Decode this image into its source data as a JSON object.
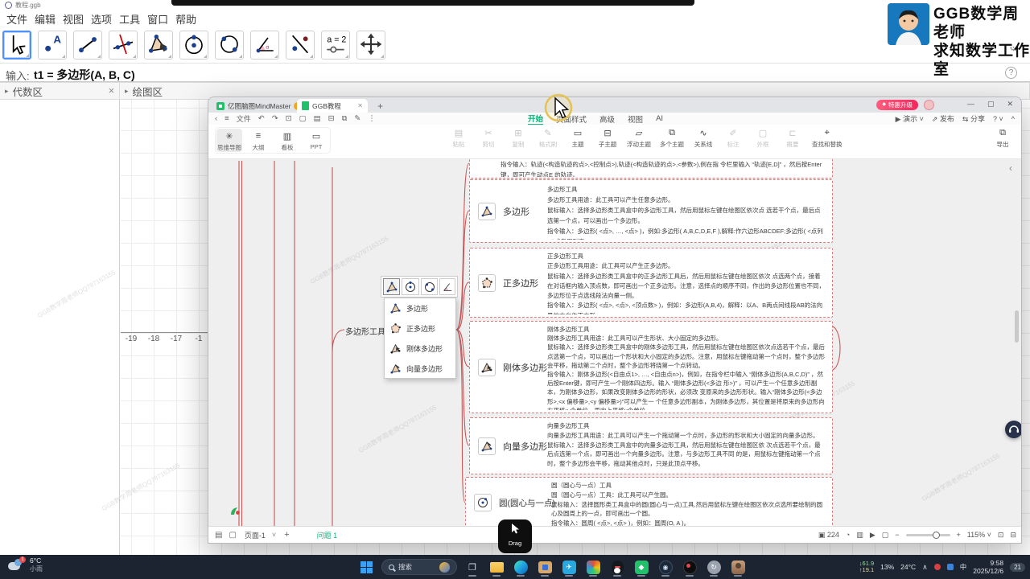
{
  "colors": {
    "mindmaster_green": "#12b27c",
    "dashed_red": "#d97b7b",
    "ggb_select_blue": "#4d90fe",
    "taskbar_bg": "#1b2430",
    "pro_orange": "#f7a41d"
  },
  "ggb": {
    "window_title": "教程.ggb",
    "menu": [
      "文件",
      "编辑",
      "视图",
      "选项",
      "工具",
      "窗口",
      "帮助"
    ],
    "input_label": "输入:",
    "input_value": "t1 = 多边形(A, B, C)",
    "algebra_panel_title": "代数区",
    "graphics_panel_title": "绘图区",
    "axis_labels": [
      "-19",
      "-18",
      "-17",
      "-1"
    ],
    "slider_tool_label": "a = 2",
    "brand_line1": "GGB数学周老师",
    "brand_line2": "求知数学工作室"
  },
  "mindmaster": {
    "tab_home": {
      "title": "亿图脑图MindMaster",
      "badge": "Pro"
    },
    "tab_doc": {
      "title": "GGB教程"
    },
    "new_tab": "+",
    "promo_badge": "特惠升级",
    "file_menu": "文件",
    "ribbon_tabs": [
      "开始",
      "页面样式",
      "高级",
      "视图",
      "AI"
    ],
    "quick_actions": [
      "演示",
      "发布",
      "分享"
    ],
    "view_modes": [
      "思维导图",
      "大纲",
      "看板",
      "PPT"
    ],
    "ribbon_items": [
      "粘贴",
      "剪切",
      "复制",
      "格式刷",
      "主题",
      "子主题",
      "浮动主题",
      "多个主题",
      "关系线",
      "标注",
      "外框",
      "概要",
      "查找和替换"
    ],
    "export_label": "导出",
    "status_left": {
      "page_tab": "页面-1",
      "green_label": "问题 1"
    },
    "status_right": {
      "topic_count": "224",
      "zoom_percent": "115%"
    },
    "drag_overlay": "Drag",
    "canvas": {
      "central_topic": "多边形工具",
      "toolbox_items": [
        "多边形",
        "正多边形",
        "刚体多边形",
        "向量多边形"
      ],
      "watermark": "GGB数学周老师QQ787163155",
      "boxes": [
        {
          "label": "",
          "body": "指令输入：轨迹(<构造轨迹的点>,<控制点>),轨迹(<构造轨迹的点>,<参数>),例在指 令栏里输入 “轨迹[E,D]” ，然后按Enter 键，即可产生动点E 的轨迹。"
        },
        {
          "label": "多边形",
          "body": "多边形工具\n多边形工具用途：此工具可以产生任意多边形。\n鼠标输入：选择多边形类工具盒中的多边形工具，然后用鼠标左键在绘图区依次点 选若干个点，最后点选第一个点，可以画出一个多边形。\n指令输入：多边形( <点>, …, <点> )，例如:多边形( A,B,C,D,E,F ),解释:作六边形ABCDEF;多边形( <点列> )或者用列表。"
        },
        {
          "label": "正多边形",
          "body": "正多边形工具\n正多边形工具用途：此工具可以产生正多边形。\n鼠标输入：选择多边形类工具盒中的正多边形工具后，然后用鼠标左键在绘图区依次 点选两个点，接着在对话框内输入顶点数，即可画出一个正多边形。注意，选择点的顺序不同，作出的多边形位置也不同，多边形位于点选线段法向量一侧。\n指令输入：多边形( <点>, <点>, <顶点数> )，例如：多边形(A,B,4)，解释：以A、B两点间线段AB的法向量的方向作正方形。"
        },
        {
          "label": "刚体多边形",
          "body": "刚体多边形工具\n刚体多边形工具用途：此工具可以产生形状、大小固定的多边形。\n鼠标输入：选择多边形类工具盒中的刚体多边形工具，然后用鼠标左键在绘图区依次点选若干个点，最后点选第一个点，可以画出一个形状和大小固定的多边形。注意，用鼠标左键拖动第一个点时，整个多边形会平移，拖动第二个点时，整个多边形将绕第一个点转动。\n指令输入：刚体多边形(<自由点1>, …, <自由点n>)，例如，在指令栏中输入 “刚体多边形(A,B,C,D)” ，然后按Enter键，即可产生一个刚体四边形。输入 “刚体多边形(<多边 形>)” ，可以产生一个任意多边形副本，为刚体多边形，如果改变刚体多边形的形状，必须改 变原来的多边形形状。输入“刚体多边形(<多边形>,<x 偏移量>,<y 偏移量>)”可以产生一 个任意多边形副本，为刚体多边形，其位置是将原来的多边形向右平移x 个单位，再向上平移y个单位。"
        },
        {
          "label": "向量多边形",
          "body": "向量多边形工具\n向量多边形工具用途：此工具可以产生一个拖动第一个点时，多边形的形状和大小固定的向量多边形。\n鼠标输入：选择多边形类工具盒中的向量多边形工具，然后用鼠标左键在绘图区依 次点选若干个点，最后点选第一个点，即可画出一个向量多边形。注意，与多边形工具不同 的是，用鼠标左键拖动第一个点时，整个多边形会平移，拖动其他点时，只是此顶点平移。"
        },
        {
          "label": "圆(圆心与一点)",
          "body": "圆（圆心与一点）工具\n圆（圆心与一点）工具：此工具可以产生圆。\n鼠标输入：选择圆形类工具盒中的圆(圆心与一点)工具,然后用鼠标左键在绘图区依次点选所要绘制的圆心及圆周上的一点，即可画出一个圆。\n指令输入：圆周( <点>, <点> )，例如：圆周(O, A )。"
        }
      ]
    }
  },
  "taskbar": {
    "weather_temp": "6°C",
    "weather_desc": "小雨",
    "search_placeholder": "搜索",
    "net_down": "↓61.9",
    "net_up": "↑19.1",
    "cpu": "13%",
    "temperature": "24°C",
    "ime": "中",
    "time": "9:58",
    "date": "2025/12/6",
    "notification_count": "21"
  }
}
